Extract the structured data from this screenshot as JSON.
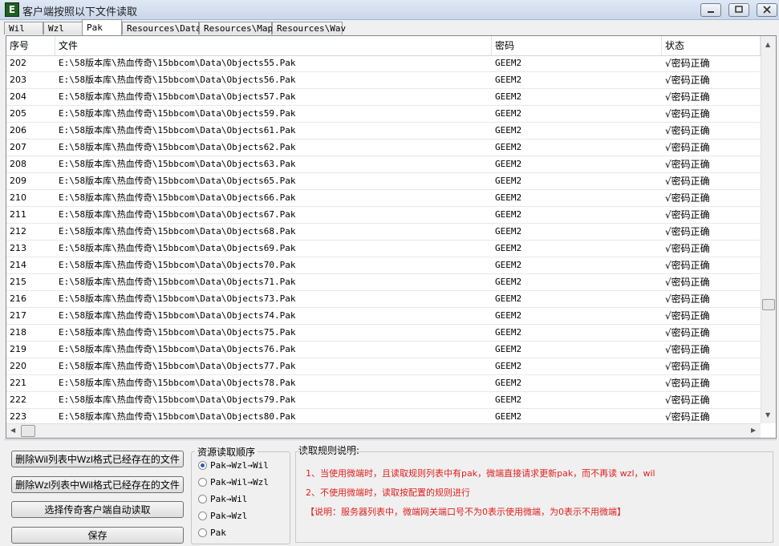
{
  "window": {
    "title": "客户端按照以下文件读取",
    "icon_letter": "E"
  },
  "tabs": [
    "Wil",
    "Wzl",
    "Pak",
    "Resources\\Data",
    "Resources\\Map",
    "Resources\\Wav"
  ],
  "active_tab": "Pak",
  "table": {
    "columns": [
      "序号",
      "文件",
      "密码",
      "状态"
    ],
    "rows": [
      {
        "id": "202",
        "file": "E:\\58版本库\\热血传奇\\15bbcom\\Data\\Objects55.Pak",
        "pwd": "GEEM2",
        "status": "√密码正确"
      },
      {
        "id": "203",
        "file": "E:\\58版本库\\热血传奇\\15bbcom\\Data\\Objects56.Pak",
        "pwd": "GEEM2",
        "status": "√密码正确"
      },
      {
        "id": "204",
        "file": "E:\\58版本库\\热血传奇\\15bbcom\\Data\\Objects57.Pak",
        "pwd": "GEEM2",
        "status": "√密码正确"
      },
      {
        "id": "205",
        "file": "E:\\58版本库\\热血传奇\\15bbcom\\Data\\Objects59.Pak",
        "pwd": "GEEM2",
        "status": "√密码正确"
      },
      {
        "id": "206",
        "file": "E:\\58版本库\\热血传奇\\15bbcom\\Data\\Objects61.Pak",
        "pwd": "GEEM2",
        "status": "√密码正确"
      },
      {
        "id": "207",
        "file": "E:\\58版本库\\热血传奇\\15bbcom\\Data\\Objects62.Pak",
        "pwd": "GEEM2",
        "status": "√密码正确"
      },
      {
        "id": "208",
        "file": "E:\\58版本库\\热血传奇\\15bbcom\\Data\\Objects63.Pak",
        "pwd": "GEEM2",
        "status": "√密码正确"
      },
      {
        "id": "209",
        "file": "E:\\58版本库\\热血传奇\\15bbcom\\Data\\Objects65.Pak",
        "pwd": "GEEM2",
        "status": "√密码正确"
      },
      {
        "id": "210",
        "file": "E:\\58版本库\\热血传奇\\15bbcom\\Data\\Objects66.Pak",
        "pwd": "GEEM2",
        "status": "√密码正确"
      },
      {
        "id": "211",
        "file": "E:\\58版本库\\热血传奇\\15bbcom\\Data\\Objects67.Pak",
        "pwd": "GEEM2",
        "status": "√密码正确"
      },
      {
        "id": "212",
        "file": "E:\\58版本库\\热血传奇\\15bbcom\\Data\\Objects68.Pak",
        "pwd": "GEEM2",
        "status": "√密码正确"
      },
      {
        "id": "213",
        "file": "E:\\58版本库\\热血传奇\\15bbcom\\Data\\Objects69.Pak",
        "pwd": "GEEM2",
        "status": "√密码正确"
      },
      {
        "id": "214",
        "file": "E:\\58版本库\\热血传奇\\15bbcom\\Data\\Objects70.Pak",
        "pwd": "GEEM2",
        "status": "√密码正确"
      },
      {
        "id": "215",
        "file": "E:\\58版本库\\热血传奇\\15bbcom\\Data\\Objects71.Pak",
        "pwd": "GEEM2",
        "status": "√密码正确"
      },
      {
        "id": "216",
        "file": "E:\\58版本库\\热血传奇\\15bbcom\\Data\\Objects73.Pak",
        "pwd": "GEEM2",
        "status": "√密码正确"
      },
      {
        "id": "217",
        "file": "E:\\58版本库\\热血传奇\\15bbcom\\Data\\Objects74.Pak",
        "pwd": "GEEM2",
        "status": "√密码正确"
      },
      {
        "id": "218",
        "file": "E:\\58版本库\\热血传奇\\15bbcom\\Data\\Objects75.Pak",
        "pwd": "GEEM2",
        "status": "√密码正确"
      },
      {
        "id": "219",
        "file": "E:\\58版本库\\热血传奇\\15bbcom\\Data\\Objects76.Pak",
        "pwd": "GEEM2",
        "status": "√密码正确"
      },
      {
        "id": "220",
        "file": "E:\\58版本库\\热血传奇\\15bbcom\\Data\\Objects77.Pak",
        "pwd": "GEEM2",
        "status": "√密码正确"
      },
      {
        "id": "221",
        "file": "E:\\58版本库\\热血传奇\\15bbcom\\Data\\Objects78.Pak",
        "pwd": "GEEM2",
        "status": "√密码正确"
      },
      {
        "id": "222",
        "file": "E:\\58版本库\\热血传奇\\15bbcom\\Data\\Objects79.Pak",
        "pwd": "GEEM2",
        "status": "√密码正确"
      },
      {
        "id": "223",
        "file": "E:\\58版本库\\热血传奇\\15bbcom\\Data\\Objects80.Pak",
        "pwd": "GEEM2",
        "status": "√密码正确"
      }
    ]
  },
  "buttons": {
    "delete_wil": "删除Wil列表中Wzl格式已经存在的文件",
    "delete_wzl": "删除Wzl列表中Wil格式已经存在的文件",
    "select_client": "选择传奇客户端自动读取",
    "save": "保存"
  },
  "source_order": {
    "title": "资源读取顺序",
    "options": [
      "Pak→Wzl→Wil",
      "Pak→Wil→Wzl",
      "Pak→Wil",
      "Pak→Wzl",
      "Pak"
    ],
    "selected": "Pak→Wzl→Wil"
  },
  "rules": {
    "title": "读取规则说明:",
    "lines": [
      "1、当使用微端时，且读取规则列表中有pak，微端直接请求更新pak，而不再读 wzl，wil",
      "2、不使用微端时，读取按配置的规则进行",
      "【说明：服务器列表中，微端网关端口号不为0表示使用微端，为0表示不用微端】"
    ],
    "color": "#e02020"
  }
}
